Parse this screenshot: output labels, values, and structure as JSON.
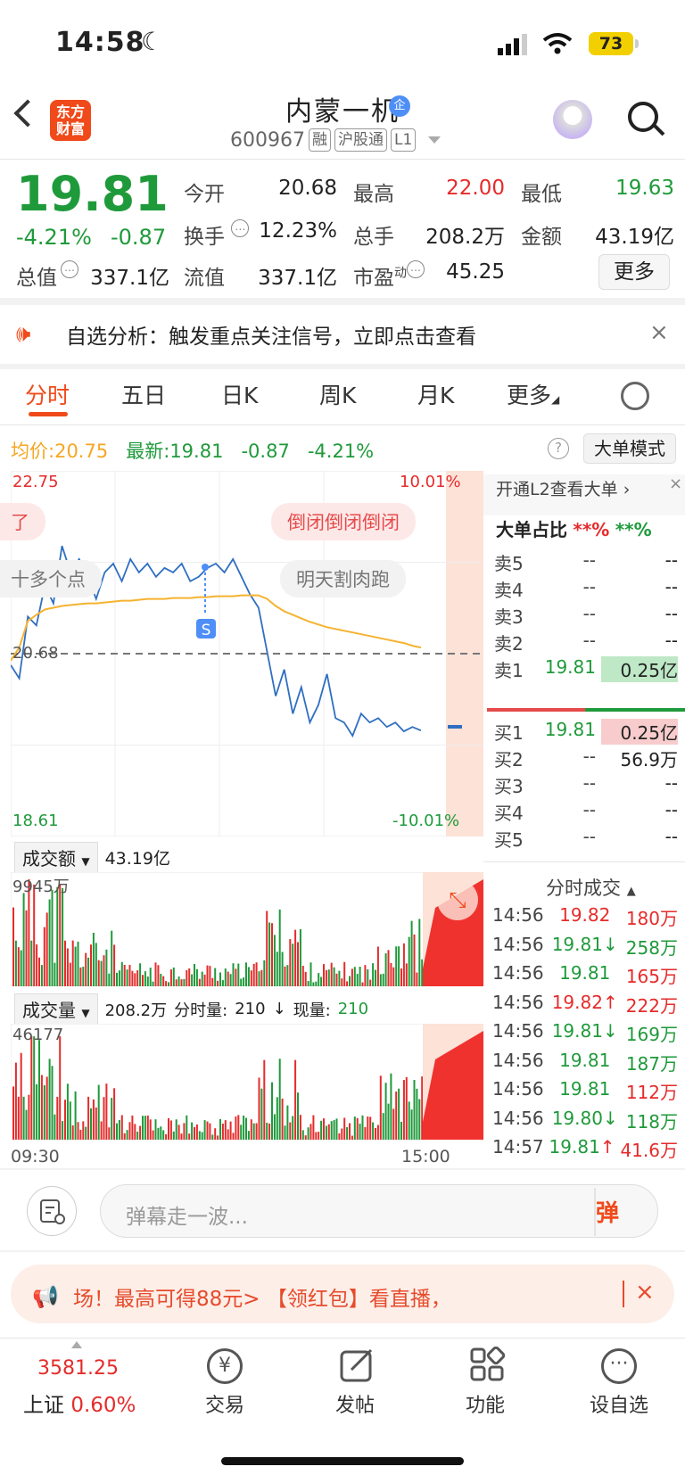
{
  "status": {
    "time": "14:58",
    "battery": "73"
  },
  "header": {
    "logo": [
      "东方",
      "财富"
    ],
    "name": "内蒙一机",
    "name_badge": "企",
    "code": "600967",
    "tags": [
      "融",
      "沪股通",
      "L1"
    ]
  },
  "quote": {
    "price": "19.81",
    "change_pct": "-4.21%",
    "change_abs": "-0.87",
    "open_label": "今开",
    "open": "20.68",
    "high_label": "最高",
    "high": "22.00",
    "low_label": "最低",
    "low": "19.63",
    "turnover_label": "换手",
    "turnover": "12.23%",
    "volume_label": "总手",
    "volume": "208.2万",
    "amount_label": "金额",
    "amount": "43.19亿",
    "mktcap_label": "总值",
    "mktcap": "337.1亿",
    "float_label": "流值",
    "float": "337.1亿",
    "pe_label": "市盈",
    "pe_sup": "动",
    "pe": "45.25",
    "more_label": "更多"
  },
  "alert": {
    "text": "自选分析：触发重点关注信号，立即点击查看"
  },
  "tabs": [
    "分时",
    "五日",
    "日K",
    "周K",
    "月K",
    "更多"
  ],
  "info": {
    "avg_label": "均价:",
    "avg": "20.75",
    "latest_label": "最新:",
    "latest": "19.81",
    "chg": "-0.87",
    "pct": "-4.21%",
    "mode_btn": "大单模式"
  },
  "chart_data": {
    "type": "line",
    "title": "",
    "y_top": "22.75",
    "y_bottom": "18.61",
    "y_ref": "20.68",
    "pct_top": "10.01%",
    "pct_bottom": "-10.01%",
    "x_start": "09:30",
    "x_end": "15:00",
    "series": [
      {
        "name": "price",
        "color": "#2f6fc1",
        "values": [
          20.55,
          20.4,
          21.1,
          21.0,
          21.45,
          21.25,
          21.9,
          21.6,
          21.75,
          21.55,
          21.3,
          21.6,
          21.7,
          21.5,
          21.75,
          21.6,
          21.7,
          21.55,
          21.65,
          21.6,
          21.7,
          21.5,
          21.55,
          21.65,
          21.7,
          21.6,
          21.75,
          21.55,
          21.35,
          21.2,
          20.7,
          20.2,
          20.5,
          20.0,
          20.3,
          19.9,
          20.1,
          20.45,
          19.95,
          19.9,
          19.75,
          20.0,
          19.9,
          19.95,
          19.85,
          19.9,
          19.8,
          19.85,
          19.81
        ]
      },
      {
        "name": "avg",
        "color": "#f5b330",
        "values": [
          20.6,
          20.75,
          21.05,
          21.12,
          21.18,
          21.2,
          21.22,
          21.23,
          21.24,
          21.25,
          21.25,
          21.26,
          21.27,
          21.28,
          21.28,
          21.29,
          21.3,
          21.3,
          21.3,
          21.31,
          21.31,
          21.31,
          21.32,
          21.32,
          21.33,
          21.33,
          21.33,
          21.34,
          21.34,
          21.34,
          21.3,
          21.22,
          21.16,
          21.12,
          21.08,
          21.04,
          21.01,
          20.98,
          20.96,
          20.94,
          20.92,
          20.9,
          20.88,
          20.86,
          20.84,
          20.82,
          20.8,
          20.77,
          20.75
        ]
      }
    ]
  },
  "bubbles": {
    "b1": "了",
    "b2": "倒闭倒闭倒闭",
    "b3": "十多个点",
    "b4": "明天割肉跑",
    "marker": "S"
  },
  "amount_panel": {
    "label": "成交额",
    "value": "43.19亿",
    "max": "9945万"
  },
  "volume_panel": {
    "label": "成交量",
    "value": "208.2万",
    "fs_label": "分时量:",
    "fs": "210",
    "now_label": "现量:",
    "now": "210",
    "max": "46177"
  },
  "l2": {
    "title": "开通L2查看大单",
    "ratio_label": "大单占比",
    "r1": "**%",
    "r2": "**%"
  },
  "asks": [
    {
      "label": "卖5",
      "price": "--",
      "vol": "--"
    },
    {
      "label": "卖4",
      "price": "--",
      "vol": "--"
    },
    {
      "label": "卖3",
      "price": "--",
      "vol": "--"
    },
    {
      "label": "卖2",
      "price": "--",
      "vol": "--"
    },
    {
      "label": "卖1",
      "price": "19.81",
      "vol": "0.25亿"
    }
  ],
  "bids": [
    {
      "label": "买1",
      "price": "19.81",
      "vol": "0.25亿"
    },
    {
      "label": "买2",
      "price": "--",
      "vol": "56.9万"
    },
    {
      "label": "买3",
      "price": "--",
      "vol": "--"
    },
    {
      "label": "买4",
      "price": "--",
      "vol": "--"
    },
    {
      "label": "买5",
      "price": "--",
      "vol": "--"
    }
  ],
  "trades_title": "分时成交",
  "trades": [
    {
      "time": "14:56",
      "price": "19.82",
      "vol": "180万",
      "dir": "",
      "vc": "red"
    },
    {
      "time": "14:56",
      "price": "19.81",
      "vol": "258万",
      "dir": "↓",
      "vc": "green"
    },
    {
      "time": "14:56",
      "price": "19.81",
      "vol": "165万",
      "dir": "",
      "vc": "red"
    },
    {
      "time": "14:56",
      "price": "19.82",
      "vol": "222万",
      "dir": "↑",
      "vc": "red"
    },
    {
      "time": "14:56",
      "price": "19.81",
      "vol": "169万",
      "dir": "↓",
      "vc": "green"
    },
    {
      "time": "14:56",
      "price": "19.81",
      "vol": "187万",
      "dir": "",
      "vc": "green"
    },
    {
      "time": "14:56",
      "price": "19.81",
      "vol": "112万",
      "dir": "",
      "vc": "red"
    },
    {
      "time": "14:56",
      "price": "19.80",
      "vol": "118万",
      "dir": "↓",
      "vc": "green"
    },
    {
      "time": "14:57",
      "price": "19.81",
      "vol": "41.6万",
      "dir": "↑",
      "vc": "red"
    }
  ],
  "comment": {
    "placeholder": "弹幕走一波...",
    "danmu": "弹"
  },
  "promo": {
    "text": "场！最高可得88元>        【领红包】看直播，"
  },
  "nav": {
    "index_value": "3581.25",
    "index_name": "上证",
    "index_pct": "0.60%",
    "items": [
      "交易",
      "发帖",
      "功能",
      "设自选"
    ]
  }
}
